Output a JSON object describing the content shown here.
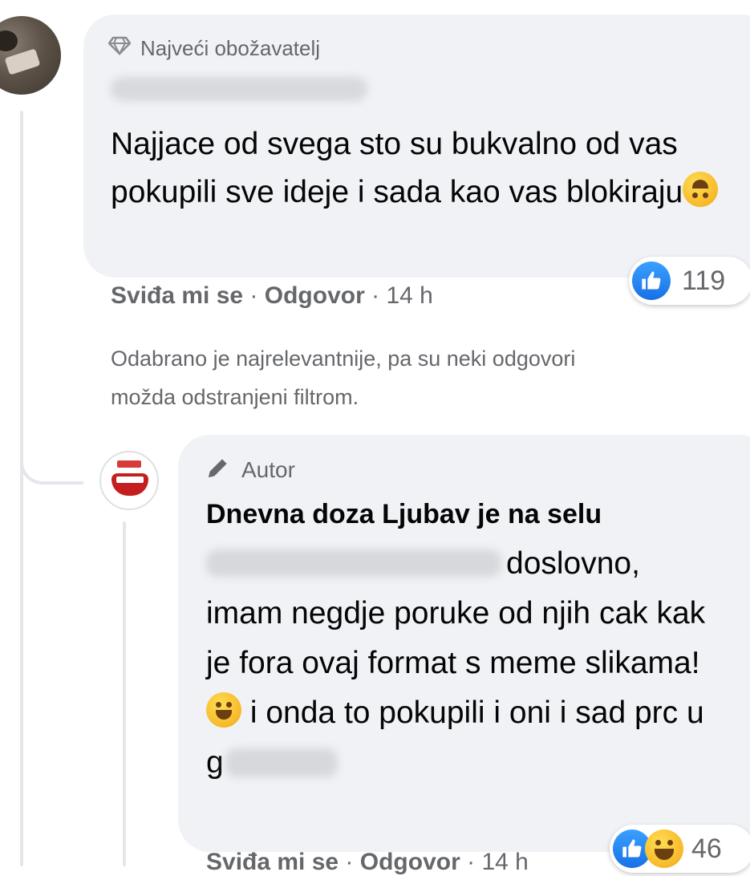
{
  "comment1": {
    "badge": "Najveći obožavatelj",
    "text": "Najjace od svega sto su bukvalno od vas pokupili sve ideje i sada kao vas blokiraju",
    "reaction_count": "119",
    "like_label": "Sviđa mi se",
    "sep": " · ",
    "reply_label": "Odgovor",
    "time": "14 h"
  },
  "filter_note": {
    "line1": "Odabrano je najrelevantnije, pa su neki odgovori",
    "line2": "možda odstranjeni filtrom."
  },
  "comment2": {
    "badge": "Autor",
    "author": "Dnevna doza Ljubav je na selu",
    "text_part1": "doslovno, imam negdje poruke od njih cak kak je fora ovaj format s meme slikama!",
    "text_part2": "i onda to pokupili i oni i sad prc u",
    "text_part3": "g",
    "reaction_count": "46",
    "like_label": "Sviđa mi se",
    "sep": " · ",
    "reply_label": "Odgovor",
    "time": "14 h"
  },
  "icons": [
    "diamond-icon",
    "pencil-icon",
    "like-reaction-icon",
    "haha-reaction-icon",
    "upside-down-face-emoji",
    "laughing-emoji"
  ],
  "colors": {
    "bubble": "#f0f2f5",
    "meta_text": "#65676b",
    "like_blue": "#1771e6",
    "reaction_yellow": "#f7b928"
  }
}
